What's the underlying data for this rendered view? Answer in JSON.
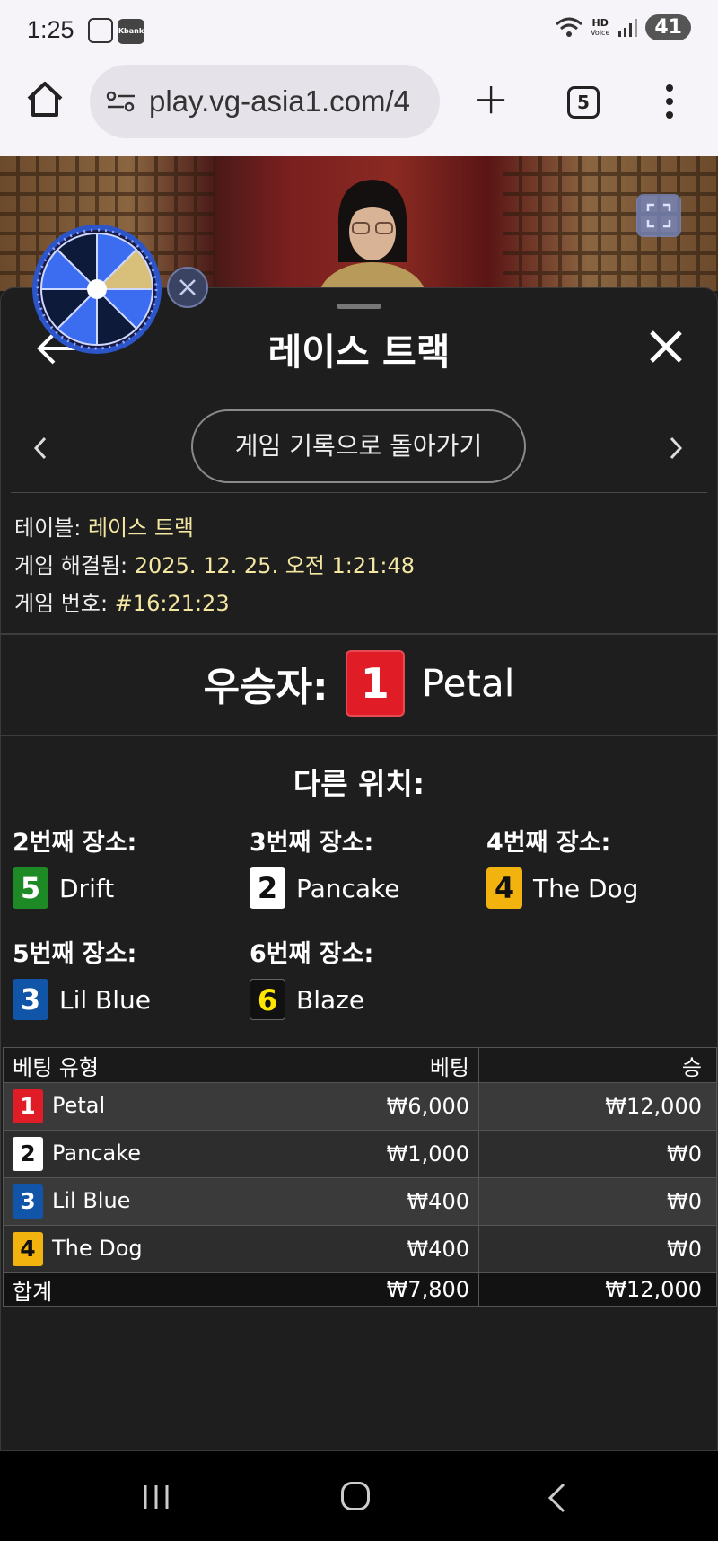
{
  "status_bar": {
    "time": "1:25",
    "kbank": "Kbank",
    "hd": "HD",
    "voice": "Voice",
    "battery": "41"
  },
  "browser": {
    "url": "play.vg-asia1.com/4",
    "tab_count": "5"
  },
  "panel": {
    "title": "레이스 트랙",
    "back_to_history": "게임 기록으로 돌아가기",
    "info": {
      "table_label": "테이블:",
      "table_value": "레이스 트랙",
      "resolved_label": "게임 해결됨:",
      "resolved_value": "2025. 12. 25. 오전 1:21:48",
      "game_no_label": "게임 번호:",
      "game_no_value": "#16:21:23"
    },
    "winner": {
      "label": "우승자:",
      "number": "1",
      "name": "Petal",
      "color": "#e01d27"
    },
    "other_positions_title": "다른 위치:",
    "places": [
      {
        "label": "2번째 장소:",
        "number": "5",
        "name": "Drift",
        "color": "#1e8a26"
      },
      {
        "label": "3번째 장소:",
        "number": "2",
        "name": "Pancake",
        "color": "#ffffff"
      },
      {
        "label": "4번째 장소:",
        "number": "4",
        "name": "The Dog",
        "color": "#f2b30f"
      },
      {
        "label": "5번째 장소:",
        "number": "3",
        "name": "Lil Blue",
        "color": "#1055a8"
      },
      {
        "label": "6번째 장소:",
        "number": "6",
        "name": "Blaze",
        "color": "#111111"
      }
    ],
    "bets_table": {
      "headers": [
        "베팅 유형",
        "베팅",
        "승"
      ],
      "rows": [
        {
          "number": "1",
          "name": "Petal",
          "bet": "₩6,000",
          "win": "₩12,000"
        },
        {
          "number": "2",
          "name": "Pancake",
          "bet": "₩1,000",
          "win": "₩0"
        },
        {
          "number": "3",
          "name": "Lil Blue",
          "bet": "₩400",
          "win": "₩0"
        },
        {
          "number": "4",
          "name": "The Dog",
          "bet": "₩400",
          "win": "₩0"
        }
      ],
      "total": {
        "label": "합계",
        "bet": "₩7,800",
        "win": "₩12,000"
      }
    }
  }
}
